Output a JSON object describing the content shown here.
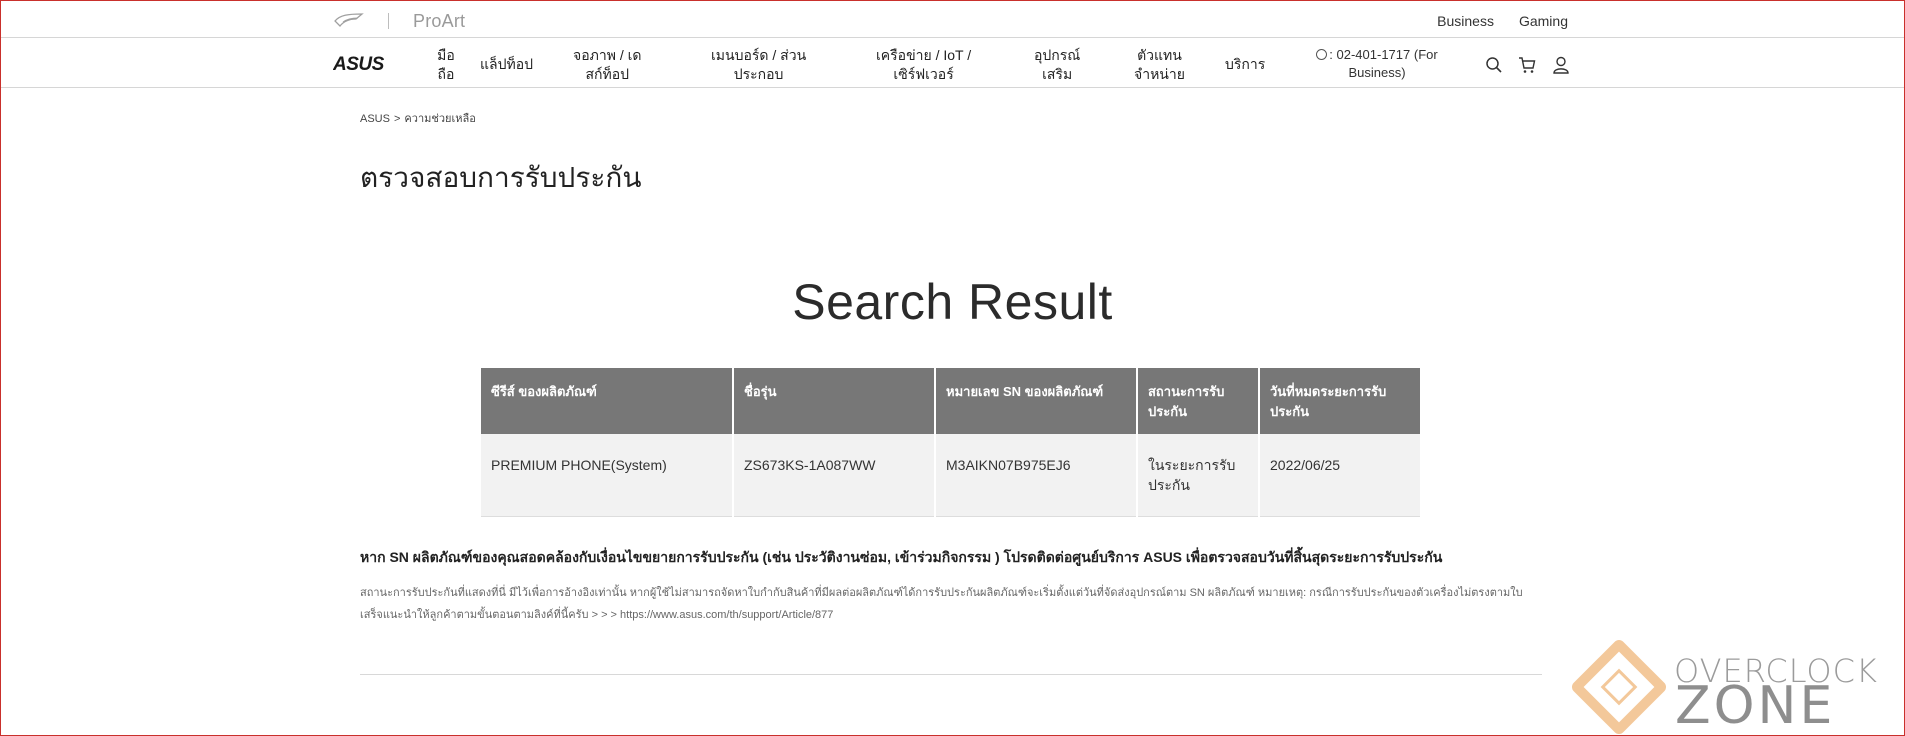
{
  "header": {
    "brand_secondary": "ProArt",
    "top_links": [
      "Business",
      "Gaming"
    ]
  },
  "nav": {
    "logo_text": "ASUS",
    "items": [
      "มือ\nถือ",
      "แล็ปท็อป",
      "จอภาพ / เด\nสก์ท็อป",
      "เมนบอร์ด / ส่วน\nประกอบ",
      "เครือข่าย / IoT /\nเซิร์ฟเวอร์",
      "อุปกรณ์\nเสริม",
      "ตัวแทน\nจำหน่าย",
      "บริการ"
    ],
    "phone": ": 02-401-1717 (For\nBusiness)",
    "icons": [
      "search-icon",
      "cart-icon",
      "user-icon"
    ]
  },
  "breadcrumb": {
    "home": "ASUS",
    "separator": ">",
    "current": "ความช่วยเหลือ"
  },
  "page": {
    "title": "ตรวจสอบการรับประกัน",
    "result_heading": "Search Result"
  },
  "table": {
    "headers": [
      "ซีรีส์ ของผลิตภัณฑ์",
      "ชื่อรุ่น",
      "หมายเลข SN ของผลิตภัณฑ์",
      "สถานะการรับ\nประกัน",
      "วันที่หมดระยะการรับ\nประกัน"
    ],
    "rows": [
      [
        "PREMIUM PHONE(System)",
        "ZS673KS-1A087WW",
        "M3AIKN07B975EJ6",
        "ในระยะการรับ\nประกัน",
        "2022/06/25"
      ]
    ]
  },
  "notice": {
    "title": "หาก SN ผลิตภัณฑ์ของคุณสอดคล้องกับเงื่อนไขขยายการรับประกัน (เช่น ประวัติงานซ่อม, เข้าร่วมกิจกรรม ) โปรดติดต่อศูนย์บริการ ASUS เพื่อตรวจสอบวันที่สิ้นสุดระยะการรับประกัน",
    "body": "สถานะการรับประกันที่แสดงที่นี่ มีไว้เพื่อการอ้างอิงเท่านั้น หากผู้ใช้ไม่สามารถจัดหาใบกำกับสินค้าที่มีผลต่อผลิตภัณฑ์ได้การรับประกันผลิตภัณฑ์จะเริ่มตั้งแต่วันที่จัดส่งอุปกรณ์ตาม SN ผลิตภัณฑ์ หมายเหตุ: กรณีการรับประกันของตัวเครื่องไม่ตรงตามใบเสร็จแนะนำให้ลูกค้าตามขั้นตอนตามลิงค์ที่นี้ครับ > > > https://www.asus.com/th/support/Article/877"
  },
  "watermark": {
    "line1": "OVERCLOCK",
    "line2": "ZONE"
  },
  "colors": {
    "table_header_bg": "#777777",
    "table_row_bg": "#f2f2f2",
    "watermark_accent": "#f3c89a"
  }
}
